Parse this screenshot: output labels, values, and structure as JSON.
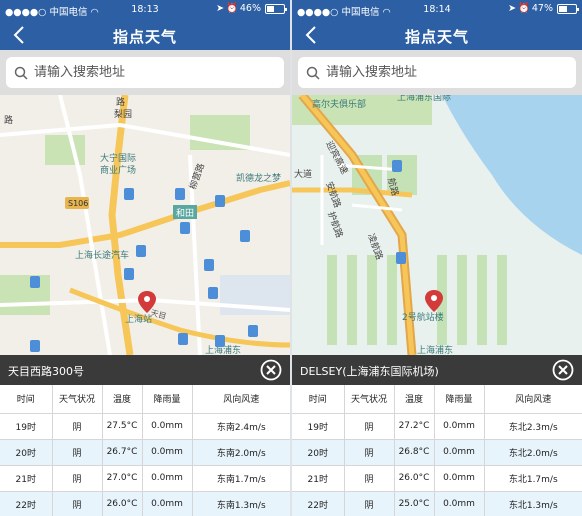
{
  "status_bar_left": {
    "carrier": "中国电信",
    "time": "18:13",
    "battery": "46%",
    "battery_level": 0.46
  },
  "status_bar_right": {
    "carrier": "中国电信",
    "time": "18:14",
    "battery": "47%",
    "battery_level": 0.47
  },
  "nav_title": "指点天气",
  "search_placeholder": "请输入搜索地址",
  "colors": {
    "nav": "#2d5fa4",
    "location_bar": "#3a3a3a",
    "row_alt": "#e8f4fb",
    "pin": "#d33a3a"
  },
  "icons": {
    "back": "chevron-left-icon",
    "search": "search-icon",
    "close": "close-circle-icon",
    "pin": "map-pin-icon",
    "gas": "gas-station-icon",
    "bus": "bus-icon",
    "metro": "metro-icon",
    "wifi": "wifi-icon",
    "battery": "battery-icon"
  },
  "map_left_labels": {
    "road_nw": "路",
    "road_ne": "路",
    "liyuan": "梨园",
    "daning": "大宁国际",
    "daning2": "商业广场",
    "liquan": "柳营路",
    "kaidekai": "凯德龙之梦",
    "s106": "S106",
    "heshan": "和田",
    "changtu": "上海长途汽车",
    "shstation": "上海站",
    "station_road": "天目西路",
    "bottom_road": "上海浦东",
    "tianmu": "天目"
  },
  "map_right_labels": {
    "club1": "上海浦东国际",
    "club2": "高尔夫俱乐部",
    "highway": "迎宾高速",
    "dadao": "大道",
    "anhang": "安航路",
    "zhanhang": "航路",
    "huhang": "护航路",
    "yuhang": "迎航路",
    "yuehang": "凌航路",
    "t2": "2号航站楼",
    "bottom": "上海浦东"
  },
  "panels": [
    {
      "location_name": "天目西路300号",
      "headers": [
        "时间",
        "天气状况",
        "温度",
        "降雨量",
        "风向风速"
      ],
      "rows": [
        [
          "19时",
          "阴",
          "27.5°C",
          "0.0mm",
          "东南2.4m/s"
        ],
        [
          "20时",
          "阴",
          "26.7°C",
          "0.0mm",
          "东南2.0m/s"
        ],
        [
          "21时",
          "阴",
          "27.0°C",
          "0.0mm",
          "东南1.7m/s"
        ],
        [
          "22时",
          "阴",
          "26.0°C",
          "0.0mm",
          "东南1.3m/s"
        ]
      ]
    },
    {
      "location_name": "DELSEY(上海浦东国际机场)",
      "headers": [
        "时间",
        "天气状况",
        "温度",
        "降雨量",
        "风向风速"
      ],
      "rows": [
        [
          "19时",
          "阴",
          "27.2°C",
          "0.0mm",
          "东北2.3m/s"
        ],
        [
          "20时",
          "阴",
          "26.8°C",
          "0.0mm",
          "东北2.0m/s"
        ],
        [
          "21时",
          "阴",
          "26.0°C",
          "0.0mm",
          "东北1.7m/s"
        ],
        [
          "22时",
          "阴",
          "25.0°C",
          "0.0mm",
          "东北1.3m/s"
        ]
      ]
    }
  ]
}
